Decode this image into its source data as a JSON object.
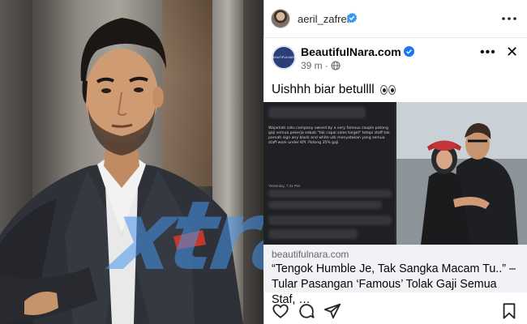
{
  "left_photo": {
    "watermark_text": "xtra"
  },
  "instagram": {
    "username": "aeril_zafrel",
    "icons": {
      "avatar": "profile-avatar",
      "verified": "verified-badge-icon",
      "more": "more-options-icon",
      "like": "heart-icon",
      "comment": "comment-icon",
      "share": "paper-plane-icon",
      "save": "bookmark-icon"
    }
  },
  "facebook_post": {
    "avatar_text": "BEAUTIFULNARA",
    "page_name": "BeautifulNara.com",
    "time": "39 m",
    "meta_separator": "·",
    "caption": "Uishhh biar betullll",
    "screenshot_text": "Wajarkah satu company owned by a very famous couple potong gaji semua pekerja sebab \"tak capai sales target\" tetapi staff tak pernah sign any black and white utk menyatakan yang semua staff work under KPI. Potong 35% gaji",
    "screenshot_time": "Yesterday, 7:31 PM",
    "link_domain": "beautifulnara.com",
    "headline": "“Tengok Humble Je, Tak Sangka Macam Tu..” – Tular Pasangan ‘Famous’ Tolak Gaji Semua Staf, …",
    "icons": {
      "verified": "verified-badge-icon",
      "public": "globe-icon",
      "more": "ellipsis-icon",
      "close": "close-icon",
      "emoji": "eyes-emoji"
    }
  },
  "colors": {
    "verified_blue": "#1877f2",
    "ig_verified_blue": "#3897f0",
    "link_box_bg": "#f0f2f5",
    "watermark": "#4696eb"
  }
}
